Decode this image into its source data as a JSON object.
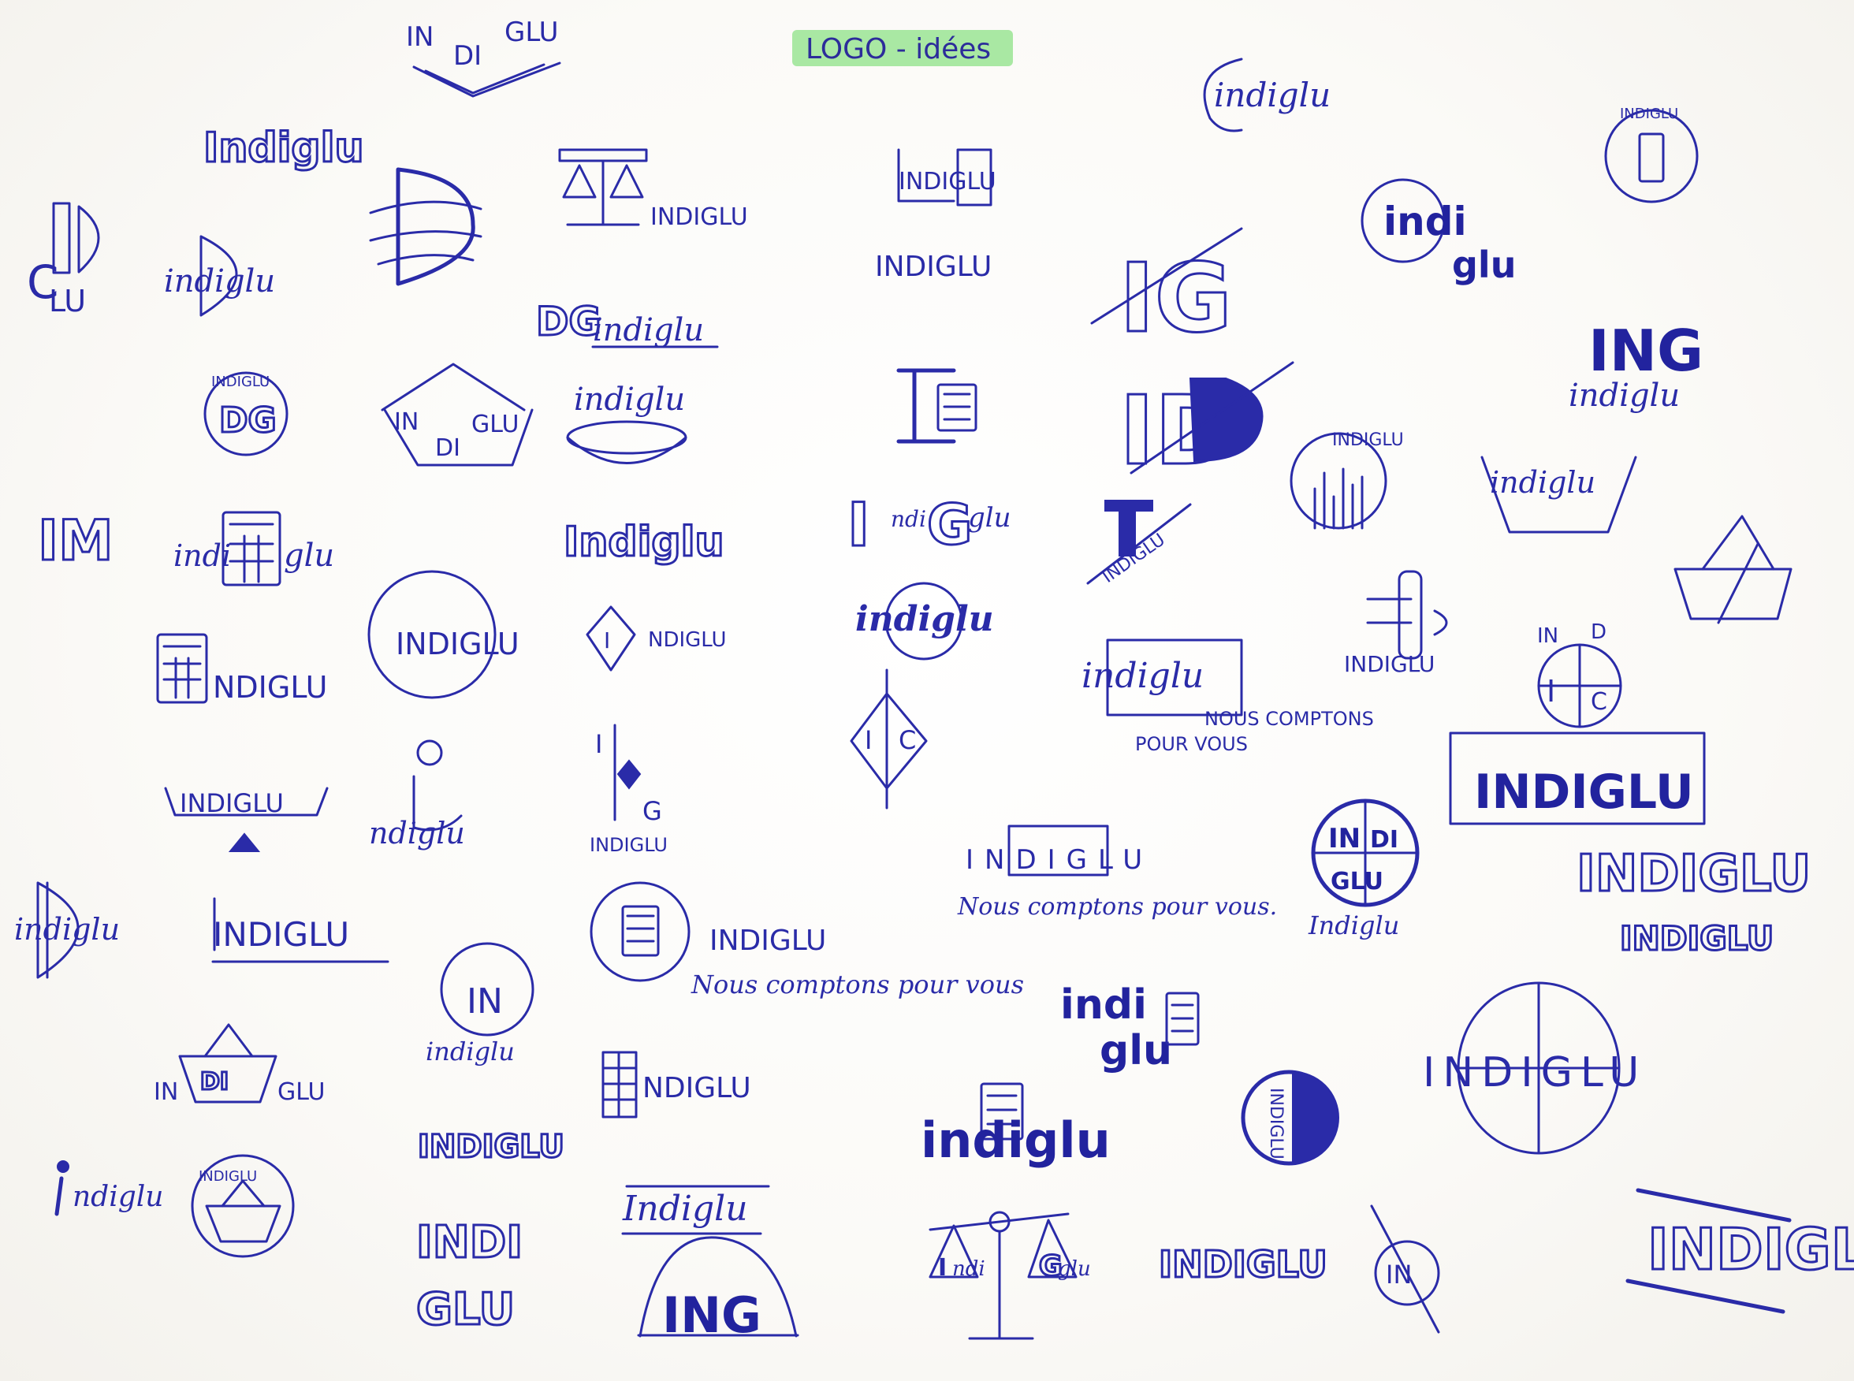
{
  "title": "LOGO - idées",
  "brand": {
    "upper": "INDIGLU",
    "lower": "indiglu",
    "title_case": "Indiglu",
    "split_upper": [
      "IN",
      "DI",
      "GLU"
    ],
    "split_lower": [
      "indi",
      "glu"
    ],
    "split_indi_glu_upper": [
      "INDI",
      "GLU"
    ],
    "initials_ig": "IG",
    "initials_id": "ID",
    "initials_ing": "ING",
    "initials_in": "IN",
    "initials_im": "IM",
    "initials_dg": "DG",
    "letter_i": "I",
    "letter_c": "C",
    "letter_g": "G",
    "letter_d": "D",
    "letters_lu": "LU",
    "name_nd": "NDIGLU",
    "name_ndiglu_lower": "ndiglu",
    "name_ndi": "ndi",
    "name_glu_lower": "glu",
    "name_nd_lower": "ndi"
  },
  "taglines": {
    "lower": "Nous comptons pour vous",
    "lower_dot": "Nous comptons pour vous.",
    "upper_line1": "NOUS COMPTONS",
    "upper_line2": "POUR VOUS"
  },
  "colors": {
    "ink": "#2a2ba8",
    "highlighter": "#a9e8a3",
    "paper": "#fbfaf8"
  }
}
